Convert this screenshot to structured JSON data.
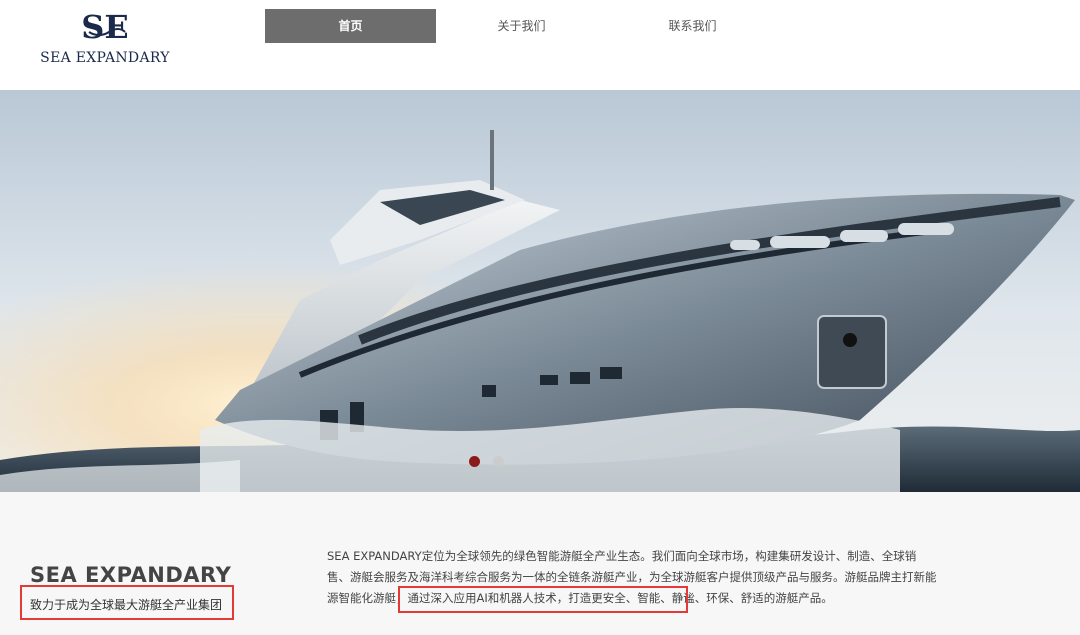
{
  "header": {
    "logo": {
      "mark_text": "SE",
      "brand_text": "SEA EXPANDARY"
    },
    "nav": [
      {
        "label": "首页",
        "active": true
      },
      {
        "label": "关于我们",
        "active": false
      },
      {
        "label": "联系我们",
        "active": false
      }
    ]
  },
  "hero": {
    "image": "yacht-on-sea",
    "carousel": {
      "total": 2,
      "active_index": 1
    }
  },
  "intro": {
    "title": "SEA EXPANDARY",
    "slogan": "致力于成为全球最大游艇全产业集团",
    "desc_1": "SEA EXPANDARY定位为全球领先的绿色智能游艇全产业生态。我们面向全球市场，构建集研发设计、制造、全球销售、游艇会服务及海洋科考综合服务为一体的全链条游艇产业，为全球游艇客户提供顶级产品与服务。游艇品牌主打",
    "desc_highlight": "新能源智能化游艇，通过深入应用AI和机器人技术，",
    "desc_2": "打造更安全、智能、静谧、环保、舒适的游艇产品。"
  },
  "colors": {
    "nav_active_bg": "#6d6d6d",
    "highlight_border": "#e53935",
    "logo_navy": "#1b2a4a",
    "dot_active": "#8b1a1a",
    "dot_inactive": "#cccccc"
  }
}
